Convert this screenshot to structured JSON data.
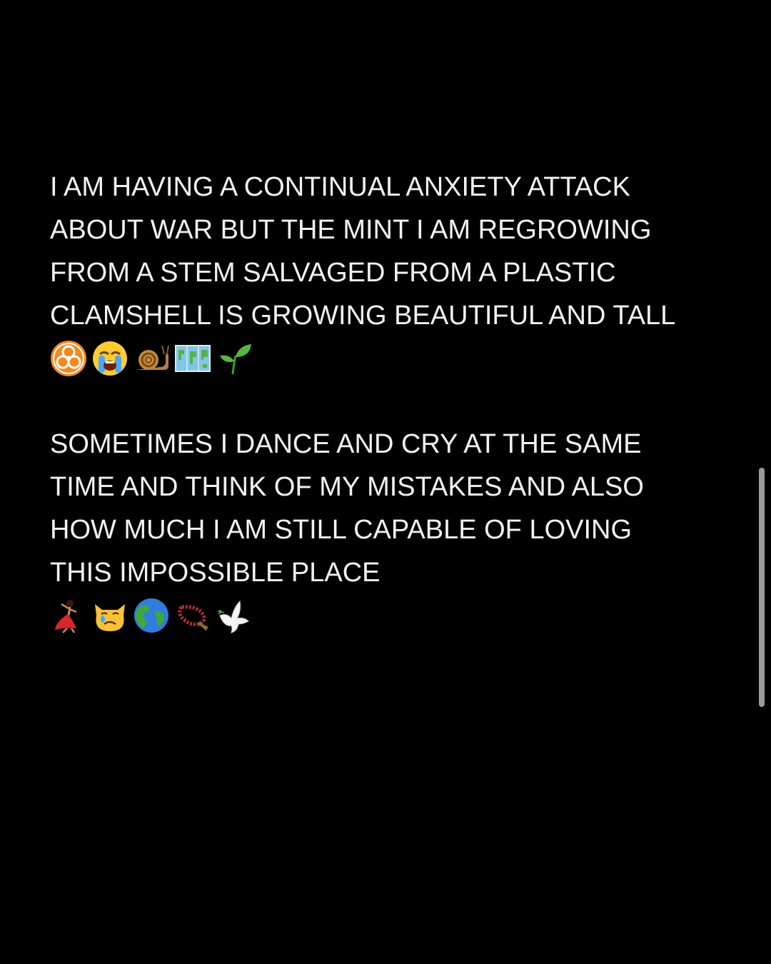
{
  "note": {
    "paragraph1": {
      "lines": [
        "I AM HAVING A CONTINUAL ANXIETY ATTACK",
        "ABOUT WAR BUT THE MINT I AM REGROWING",
        "FROM A STEM SALVAGED FROM A PLASTIC",
        "CLAMSHELL IS GROWING BEAUTIFUL AND TALL"
      ],
      "emojis": [
        "biohazard-icon",
        "loudly-crying-face-icon",
        "snail-icon",
        "world-map-icon",
        "seedling-icon"
      ]
    },
    "paragraph2": {
      "lines": [
        "SOMETIMES I DANCE AND CRY AT THE SAME",
        "TIME AND THINK OF MY MISTAKES AND ALSO",
        "HOW MUCH I AM STILL CAPABLE OF LOVING",
        "THIS IMPOSSIBLE PLACE"
      ],
      "emojis": [
        "dancer-icon",
        "crying-cat-icon",
        "globe-icon",
        "prayer-beads-icon",
        "dove-icon"
      ]
    }
  },
  "colors": {
    "background": "#000000",
    "text": "#f2f2f2",
    "scrollbar": "#9a9a9a"
  }
}
